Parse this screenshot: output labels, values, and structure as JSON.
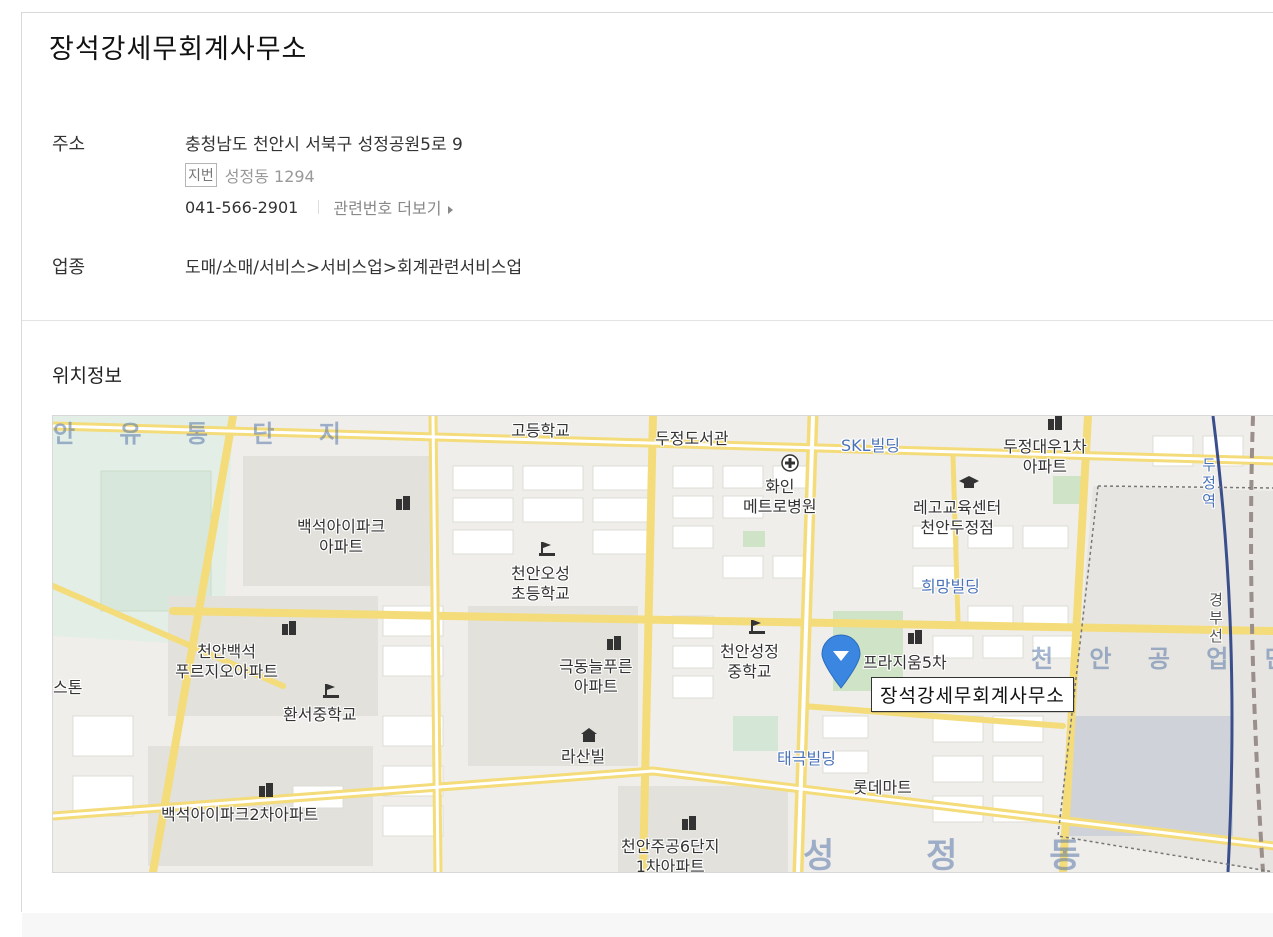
{
  "business": {
    "name": "장석강세무회계사무소"
  },
  "address": {
    "label": "주소",
    "road": "충청남도 천안시 서북구 성정공원5로 9",
    "jibun_tag": "지번",
    "jibun": "성정동 1294",
    "phone": "041-566-2901",
    "related_link": "관련번호 더보기"
  },
  "category": {
    "label": "업종",
    "value": "도매/소매/서비스>서비스업>회계관련서비스업"
  },
  "location": {
    "title": "위치정보"
  },
  "map": {
    "pin_label": "장석강세무회계사무소",
    "labels": {
      "area_west": "안 유 통 단 지",
      "area_east": "천 안 공 업 단 지",
      "gohakgyo": "고등학교",
      "dujeong_library": "두정도서관",
      "skl": "SKL빌딩",
      "dujeong_daewoo": "두정대우1차\n아파트",
      "hwain_hospital": "화인\n메트로병원",
      "lego_center": "레고교육센터\n천안두정점",
      "baekseok_ipark": "백석아이파크\n아파트",
      "osung_school": "천안오성\n초등학교",
      "huimang": "희망빌딩",
      "baekseok_prugio": "천안백석\n푸르지오아파트",
      "geukdong": "극동늘푸른\n아파트",
      "seongjeong_middle": "천안성정\n중학교",
      "prasium": "프라지움5차",
      "stone": "스톤",
      "hwanseo_middle": "환서중학교",
      "rasanvil": "라산빌",
      "taegeuk": "태극빌딩",
      "lotte_mart": "롯데마트",
      "baekseok_ipark2": "백석아이파크2차아파트",
      "jugong6": "천안주공6단지\n1차아파트",
      "dujeong_station": "두정역",
      "rail_line": "경부선",
      "seongjeong_big": "성 정 동"
    }
  },
  "colors": {
    "accent_blue": "#3a86e0",
    "road": "#f5e27a",
    "block": "#ffffff",
    "land": "#efeeea"
  }
}
